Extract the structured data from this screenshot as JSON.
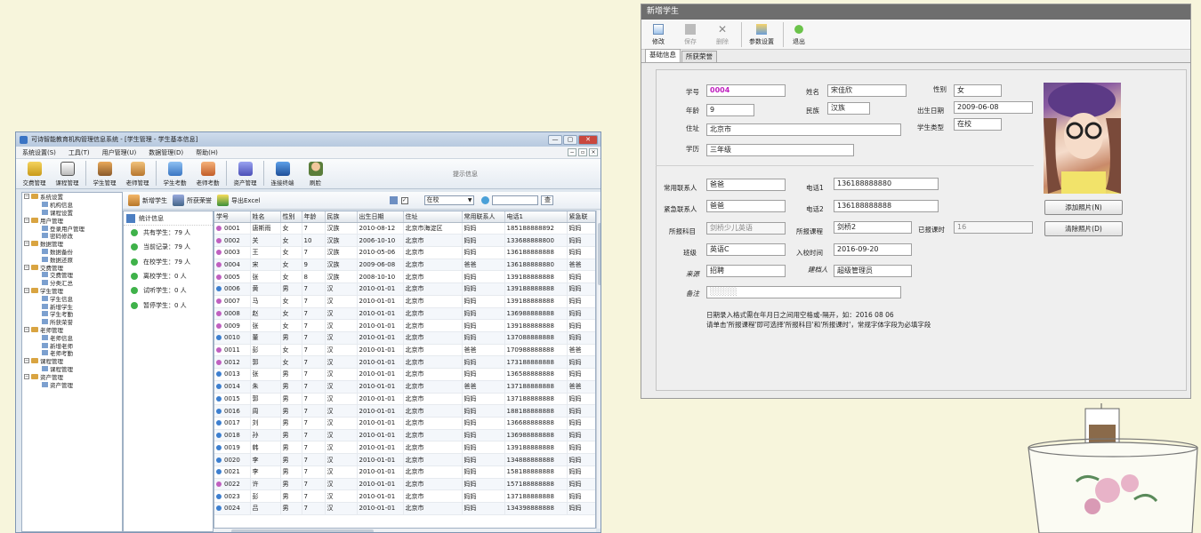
{
  "win1": {
    "title": "可诗智能教育机构管理信息系统 - [学生管理 - 学生基本信息]",
    "title_buttons": [
      "—",
      "▢",
      "✕"
    ],
    "menu": [
      "系统设置(S)",
      "工具(T)",
      "用户管理(U)",
      "数据管理(D)",
      "帮助(H)"
    ],
    "menu_right": [
      "−",
      "▫",
      "×"
    ],
    "toolbar": [
      "交费管理",
      "课程管理",
      "学生管理",
      "老师管理",
      "学生考勤",
      "老师考勤",
      "资产管理",
      "连接终端",
      "刷脸"
    ],
    "hint": "提示信息",
    "tree": [
      {
        "label": "系统设置",
        "level": 0
      },
      {
        "label": "机构信息",
        "level": 1
      },
      {
        "label": "课程设置",
        "level": 1
      },
      {
        "label": "用户管理",
        "level": 0
      },
      {
        "label": "登录用户管理",
        "level": 1
      },
      {
        "label": "密码修改",
        "level": 1
      },
      {
        "label": "数据管理",
        "level": 0
      },
      {
        "label": "数据备份",
        "level": 1
      },
      {
        "label": "数据还原",
        "level": 1
      },
      {
        "label": "交费管理",
        "level": 0
      },
      {
        "label": "交费管理",
        "level": 1
      },
      {
        "label": "分类汇总",
        "level": 1
      },
      {
        "label": "学生管理",
        "level": 0
      },
      {
        "label": "学生信息",
        "level": 1
      },
      {
        "label": "新增学生",
        "level": 1
      },
      {
        "label": "学生考勤",
        "level": 1
      },
      {
        "label": "所获荣誉",
        "level": 1
      },
      {
        "label": "老师管理",
        "level": 0
      },
      {
        "label": "老师信息",
        "level": 1
      },
      {
        "label": "新增老师",
        "level": 1
      },
      {
        "label": "老师考勤",
        "level": 1
      },
      {
        "label": "课程管理",
        "level": 0
      },
      {
        "label": "课程管理",
        "level": 1
      },
      {
        "label": "资产管理",
        "level": 0
      },
      {
        "label": "资产管理",
        "level": 1
      }
    ],
    "subtoolbar": {
      "add": "新增学生",
      "honor": "所获荣誉",
      "export": "导出Excel",
      "filter_value": "在校",
      "search_button": "查"
    },
    "stats": {
      "header": "统计信息",
      "items": [
        "共有学生：79 人",
        "当前记录：79 人",
        "在校学生：79 人",
        "离校学生：0 人",
        "试听学生：0 人",
        "暂停学生：0 人"
      ]
    },
    "columns": [
      "学号",
      "姓名",
      "性别",
      "年龄",
      "民族",
      "出生日期",
      "住址",
      "常用联系人",
      "电话1",
      "紧急联"
    ],
    "rows": [
      {
        "c": "#c060c0",
        "id": "0001",
        "name": "唐斯雨",
        "sex": "女",
        "age": "7",
        "nation": "汉族",
        "birth": "2010-08-12",
        "addr": "北京市海淀区",
        "contact": "妈妈",
        "phone": "185188888892",
        "ec": "妈妈"
      },
      {
        "c": "#c060c0",
        "id": "0002",
        "name": "关",
        "sex": "女",
        "age": "10",
        "nation": "汉族",
        "birth": "2006-10-10",
        "addr": "北京市",
        "contact": "妈妈",
        "phone": "133688888800",
        "ec": "妈妈"
      },
      {
        "c": "#c060c0",
        "id": "0003",
        "name": "王",
        "sex": "女",
        "age": "7",
        "nation": "汉族",
        "birth": "2010-05-06",
        "addr": "北京市",
        "contact": "妈妈",
        "phone": "136188888888",
        "ec": "妈妈"
      },
      {
        "c": "#c060c0",
        "id": "0004",
        "name": "宋",
        "sex": "女",
        "age": "9",
        "nation": "汉族",
        "birth": "2009-06-08",
        "addr": "北京市",
        "contact": "爸爸",
        "phone": "136188888880",
        "ec": "爸爸"
      },
      {
        "c": "#c060c0",
        "id": "0005",
        "name": "张",
        "sex": "女",
        "age": "8",
        "nation": "汉族",
        "birth": "2008-10-10",
        "addr": "北京市",
        "contact": "妈妈",
        "phone": "139188888888",
        "ec": "妈妈"
      },
      {
        "c": "#3c7fd0",
        "id": "0006",
        "name": "黄",
        "sex": "男",
        "age": "7",
        "nation": "汉",
        "birth": "2010-01-01",
        "addr": "北京市",
        "contact": "妈妈",
        "phone": "139188888888",
        "ec": "妈妈"
      },
      {
        "c": "#c060c0",
        "id": "0007",
        "name": "马",
        "sex": "女",
        "age": "7",
        "nation": "汉",
        "birth": "2010-01-01",
        "addr": "北京市",
        "contact": "妈妈",
        "phone": "139188888888",
        "ec": "妈妈"
      },
      {
        "c": "#c060c0",
        "id": "0008",
        "name": "赵",
        "sex": "女",
        "age": "7",
        "nation": "汉",
        "birth": "2010-01-01",
        "addr": "北京市",
        "contact": "妈妈",
        "phone": "136988888888",
        "ec": "妈妈"
      },
      {
        "c": "#c060c0",
        "id": "0009",
        "name": "张",
        "sex": "女",
        "age": "7",
        "nation": "汉",
        "birth": "2010-01-01",
        "addr": "北京市",
        "contact": "妈妈",
        "phone": "139188888888",
        "ec": "妈妈"
      },
      {
        "c": "#3c7fd0",
        "id": "0010",
        "name": "董",
        "sex": "男",
        "age": "7",
        "nation": "汉",
        "birth": "2010-01-01",
        "addr": "北京市",
        "contact": "妈妈",
        "phone": "137088888888",
        "ec": "妈妈"
      },
      {
        "c": "#c060c0",
        "id": "0011",
        "name": "彭",
        "sex": "女",
        "age": "7",
        "nation": "汉",
        "birth": "2010-01-01",
        "addr": "北京市",
        "contact": "爸爸",
        "phone": "170988888888",
        "ec": "爸爸"
      },
      {
        "c": "#c060c0",
        "id": "0012",
        "name": "郭",
        "sex": "女",
        "age": "7",
        "nation": "汉",
        "birth": "2010-01-01",
        "addr": "北京市",
        "contact": "妈妈",
        "phone": "173188888888",
        "ec": "妈妈"
      },
      {
        "c": "#3c7fd0",
        "id": "0013",
        "name": "张",
        "sex": "男",
        "age": "7",
        "nation": "汉",
        "birth": "2010-01-01",
        "addr": "北京市",
        "contact": "妈妈",
        "phone": "136588888888",
        "ec": "妈妈"
      },
      {
        "c": "#3c7fd0",
        "id": "0014",
        "name": "朱",
        "sex": "男",
        "age": "7",
        "nation": "汉",
        "birth": "2010-01-01",
        "addr": "北京市",
        "contact": "爸爸",
        "phone": "137188888888",
        "ec": "爸爸"
      },
      {
        "c": "#3c7fd0",
        "id": "0015",
        "name": "郭",
        "sex": "男",
        "age": "7",
        "nation": "汉",
        "birth": "2010-01-01",
        "addr": "北京市",
        "contact": "妈妈",
        "phone": "137188888888",
        "ec": "妈妈"
      },
      {
        "c": "#3c7fd0",
        "id": "0016",
        "name": "周",
        "sex": "男",
        "age": "7",
        "nation": "汉",
        "birth": "2010-01-01",
        "addr": "北京市",
        "contact": "妈妈",
        "phone": "188188888888",
        "ec": "妈妈"
      },
      {
        "c": "#3c7fd0",
        "id": "0017",
        "name": "刘",
        "sex": "男",
        "age": "7",
        "nation": "汉",
        "birth": "2010-01-01",
        "addr": "北京市",
        "contact": "妈妈",
        "phone": "136688888888",
        "ec": "妈妈"
      },
      {
        "c": "#3c7fd0",
        "id": "0018",
        "name": "孙",
        "sex": "男",
        "age": "7",
        "nation": "汉",
        "birth": "2010-01-01",
        "addr": "北京市",
        "contact": "妈妈",
        "phone": "136988888888",
        "ec": "妈妈"
      },
      {
        "c": "#3c7fd0",
        "id": "0019",
        "name": "韩",
        "sex": "男",
        "age": "7",
        "nation": "汉",
        "birth": "2010-01-01",
        "addr": "北京市",
        "contact": "妈妈",
        "phone": "139188888888",
        "ec": "妈妈"
      },
      {
        "c": "#3c7fd0",
        "id": "0020",
        "name": "李",
        "sex": "男",
        "age": "7",
        "nation": "汉",
        "birth": "2010-01-01",
        "addr": "北京市",
        "contact": "妈妈",
        "phone": "134888888888",
        "ec": "妈妈"
      },
      {
        "c": "#3c7fd0",
        "id": "0021",
        "name": "李",
        "sex": "男",
        "age": "7",
        "nation": "汉",
        "birth": "2010-01-01",
        "addr": "北京市",
        "contact": "妈妈",
        "phone": "158188888888",
        "ec": "妈妈"
      },
      {
        "c": "#c060c0",
        "id": "0022",
        "name": "许",
        "sex": "男",
        "age": "7",
        "nation": "汉",
        "birth": "2010-01-01",
        "addr": "北京市",
        "contact": "妈妈",
        "phone": "157188888888",
        "ec": "妈妈"
      },
      {
        "c": "#3c7fd0",
        "id": "0023",
        "name": "彭",
        "sex": "男",
        "age": "7",
        "nation": "汉",
        "birth": "2010-01-01",
        "addr": "北京市",
        "contact": "妈妈",
        "phone": "137188888888",
        "ec": "妈妈"
      },
      {
        "c": "#3c7fd0",
        "id": "0024",
        "name": "吕",
        "sex": "男",
        "age": "7",
        "nation": "汉",
        "birth": "2010-01-01",
        "addr": "北京市",
        "contact": "妈妈",
        "phone": "134398888888",
        "ec": "妈妈"
      }
    ]
  },
  "win2": {
    "title": "新增学生",
    "toolbar": [
      {
        "label": "修改",
        "enabled": true
      },
      {
        "label": "保存",
        "enabled": false
      },
      {
        "label": "删除",
        "enabled": false
      },
      {
        "label": "参数设置",
        "enabled": true
      },
      {
        "label": "退出",
        "enabled": true
      }
    ],
    "tabs": [
      "基础信息",
      "所获荣誉"
    ],
    "form": {
      "student_no_label": "学号",
      "student_no": "0004",
      "name_label": "姓名",
      "name": "宋佳欣",
      "gender_label": "性别",
      "gender": "女",
      "age_label": "年龄",
      "age": "9",
      "nation_label": "民族",
      "nation": "汉族",
      "birth_label": "出生日期",
      "birth": "2009-06-08",
      "address_label": "住址",
      "address": "北京市",
      "stu_type_label": "学生类型",
      "stu_type": "在校",
      "edu_label": "学历",
      "edu": "三年级",
      "contact_label": "常用联系人",
      "contact": "爸爸",
      "phone1_label": "电话1",
      "phone1": "136188888880",
      "emerg_label": "紧急联系人",
      "emerg": "爸爸",
      "phone2_label": "电话2",
      "phone2": "136188888888",
      "subject_label": "所报科目",
      "subject": "剑桥少儿英语",
      "course_label": "所报课程",
      "course": "剑桥2",
      "hours_label": "已报课时",
      "hours": "16",
      "class_label": "班级",
      "class": "英语C",
      "enroll_label": "入校时间",
      "enroll": "2016-09-20",
      "source_label": "来源",
      "source": "招聘",
      "handler_label": "建档人",
      "handler": "超级管理员",
      "remark_label": "备注",
      "remark": "░░░░░",
      "add_photo": "添加照片(N)",
      "clear_photo": "清除照片(D)",
      "note1": "日期录入格式需在年月日之间用空格或-隔开，如：2016 08 06",
      "note2": "请单击'所报课程'即可选择'所报科目'和'所报课时'，常规字体字段为必填字段"
    }
  },
  "colors": {
    "accent": "#c020c0",
    "title2": "#6e6e6e",
    "bg": "#f7f5dc"
  }
}
